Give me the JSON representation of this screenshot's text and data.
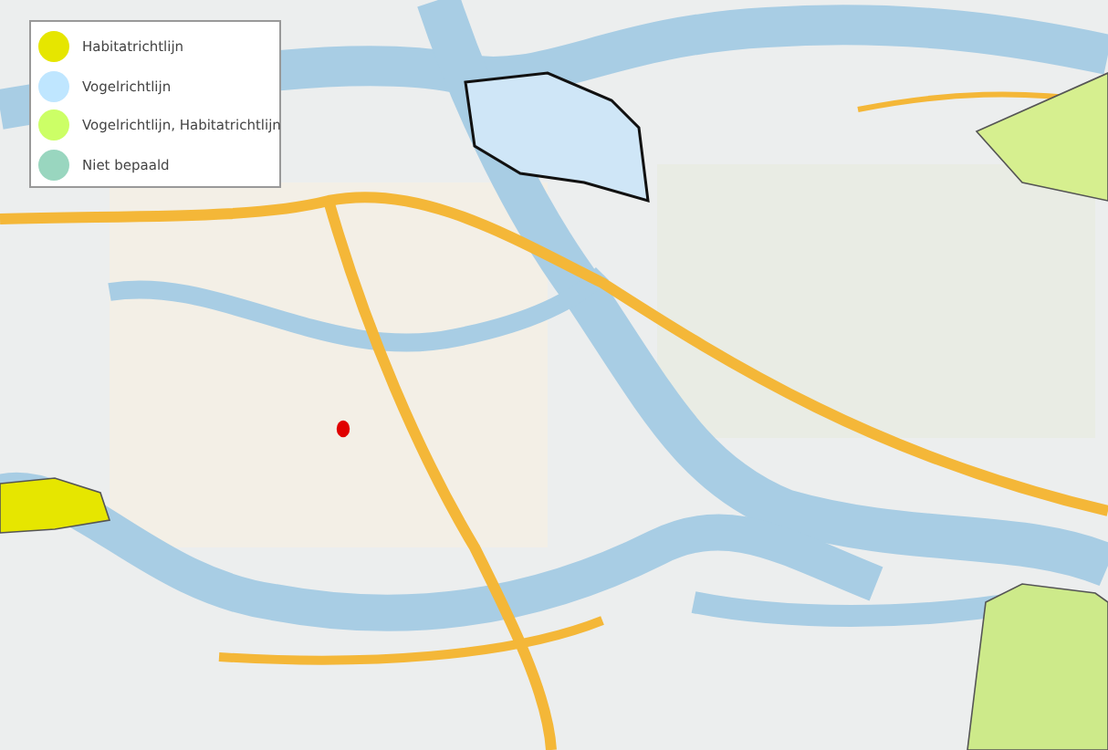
{
  "legend": {
    "items": [
      {
        "label": "Habitatrichtlijn",
        "color": "#e6e600"
      },
      {
        "label": "Vogelrichtlijn",
        "color": "#bfe6ff"
      },
      {
        "label": "Vogelrichtlijn, Habitatrichtlijn",
        "color": "#ccff66"
      },
      {
        "label": "Niet bepaald",
        "color": "#99d6bf"
      }
    ]
  }
}
